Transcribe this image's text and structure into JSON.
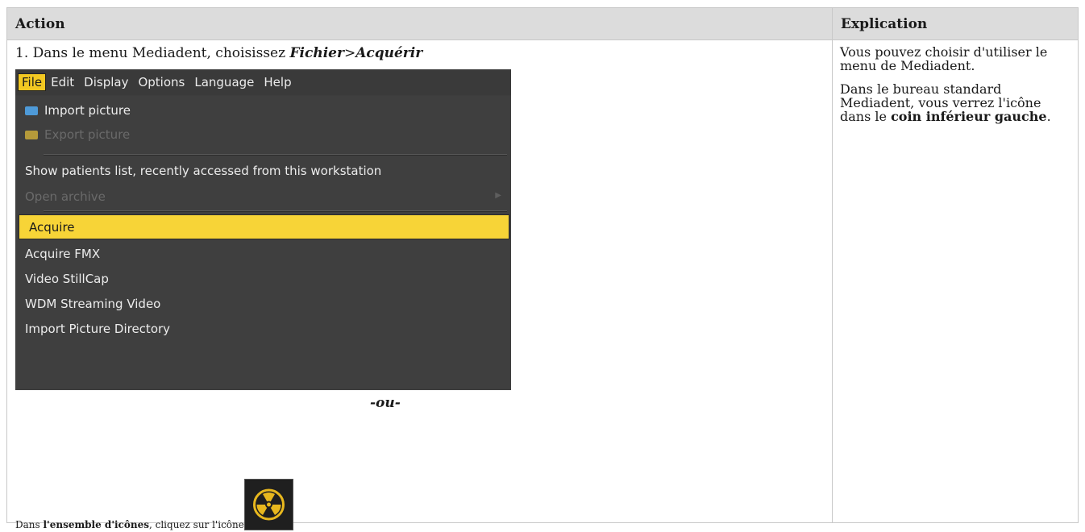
{
  "table": {
    "headers": [
      "Action",
      "Explication"
    ]
  },
  "action": {
    "step_prefix": "1. Dans le menu Mediadent, choisissez ",
    "menu_path_file": "Fichier",
    "menu_path_sep": ">",
    "menu_path_acquire": "Acquérir",
    "or_text": "-ou-",
    "icon_text_prefix": "Dans ",
    "icon_text_bold": "l'ensemble d'icônes",
    "icon_text_suffix": ", cliquez sur l'icône"
  },
  "menu": {
    "menubar": [
      "File",
      "Edit",
      "Display",
      "Options",
      "Language",
      "Help"
    ],
    "active_menu": "File",
    "items": {
      "import_picture": "Import picture",
      "export_picture": "Export picture",
      "show_patients": "Show patients list, recently accessed from this workstation",
      "open_archive": "Open archive",
      "acquire": "Acquire",
      "acquire_fmx": "Acquire FMX",
      "video_stillcap": "Video StillCap",
      "wdm_streaming": "WDM Streaming Video",
      "import_dir": "Import Picture Directory"
    },
    "colors": {
      "highlight": "#f7d437",
      "background": "#3f3f3f",
      "disabled": "#6a6a6a"
    }
  },
  "explication": {
    "p1": "Vous pouvez choisir d'utiliser le menu de Mediadent.",
    "p2_prefix": "Dans le bureau standard Mediadent, vous verrez l'icône dans le ",
    "p2_bold": "coin inférieur gauche",
    "p2_suffix": "."
  },
  "icons": {
    "import": "import-picture-icon",
    "export": "export-picture-icon",
    "submenu": "submenu-arrow-icon",
    "cursor": "mouse-cursor-icon",
    "acquire": "radiation-icon"
  }
}
